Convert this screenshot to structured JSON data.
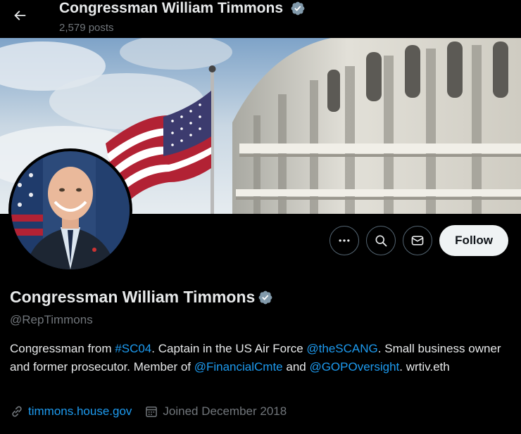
{
  "header": {
    "back_label": "Back",
    "name": "Congressman William Timmons",
    "posts_count": "2,579 posts"
  },
  "profile": {
    "name": "Congressman William Timmons",
    "handle": "@RepTimmons",
    "verified": true
  },
  "actions": {
    "more_label": "More",
    "search_label": "Search",
    "message_label": "Message",
    "follow_label": "Follow"
  },
  "bio": {
    "part1": "Congressman from ",
    "hashtag": "#SC04",
    "part2": ". Captain in the US Air Force ",
    "mention1": "@theSCANG",
    "part3": ". Small business owner and former prosecutor. Member of ",
    "mention2": "@FinancialCmte",
    "part4": " and ",
    "mention3": "@GOPOversight",
    "part5": ". wrtiv.eth"
  },
  "meta": {
    "website": "timmons.house.gov",
    "joined": "Joined December 2018"
  },
  "colors": {
    "accent": "#1d9bf0",
    "verified_badge": "#829aab",
    "follow_bg": "#eff3f4",
    "secondary_text": "#71767b"
  }
}
